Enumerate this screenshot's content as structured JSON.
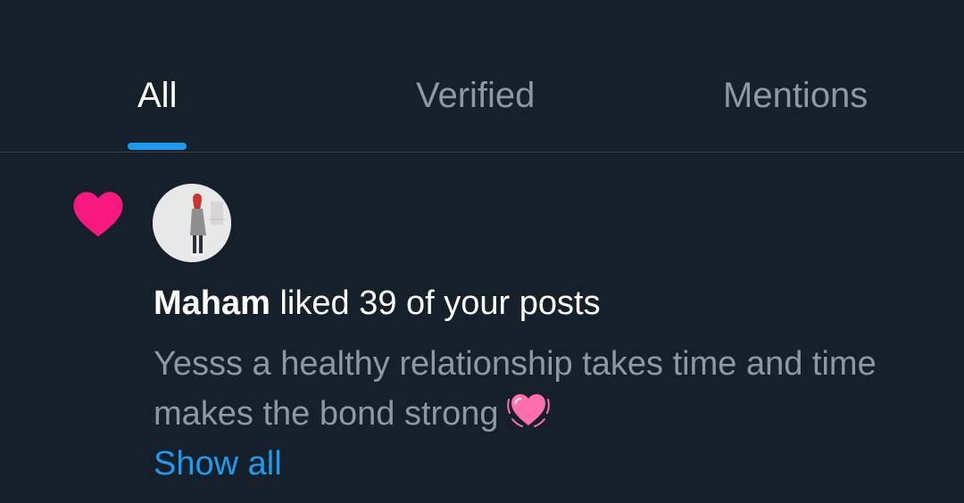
{
  "tabs": [
    {
      "label": "All",
      "active": true
    },
    {
      "label": "Verified",
      "active": false
    },
    {
      "label": "Mentions",
      "active": false
    }
  ],
  "notification": {
    "icon": "heart-icon",
    "icon_color": "#f91880",
    "user_name": "Maham",
    "action_text": "liked 39 of your posts",
    "post_text": "Yesss a healthy relationship takes time and time makes the bond strong",
    "post_emoji": "💓",
    "show_all_label": "Show all"
  },
  "colors": {
    "background": "#15202b",
    "accent": "#1d9bf0",
    "muted_text": "#8b98a5",
    "divider": "#38444d"
  }
}
